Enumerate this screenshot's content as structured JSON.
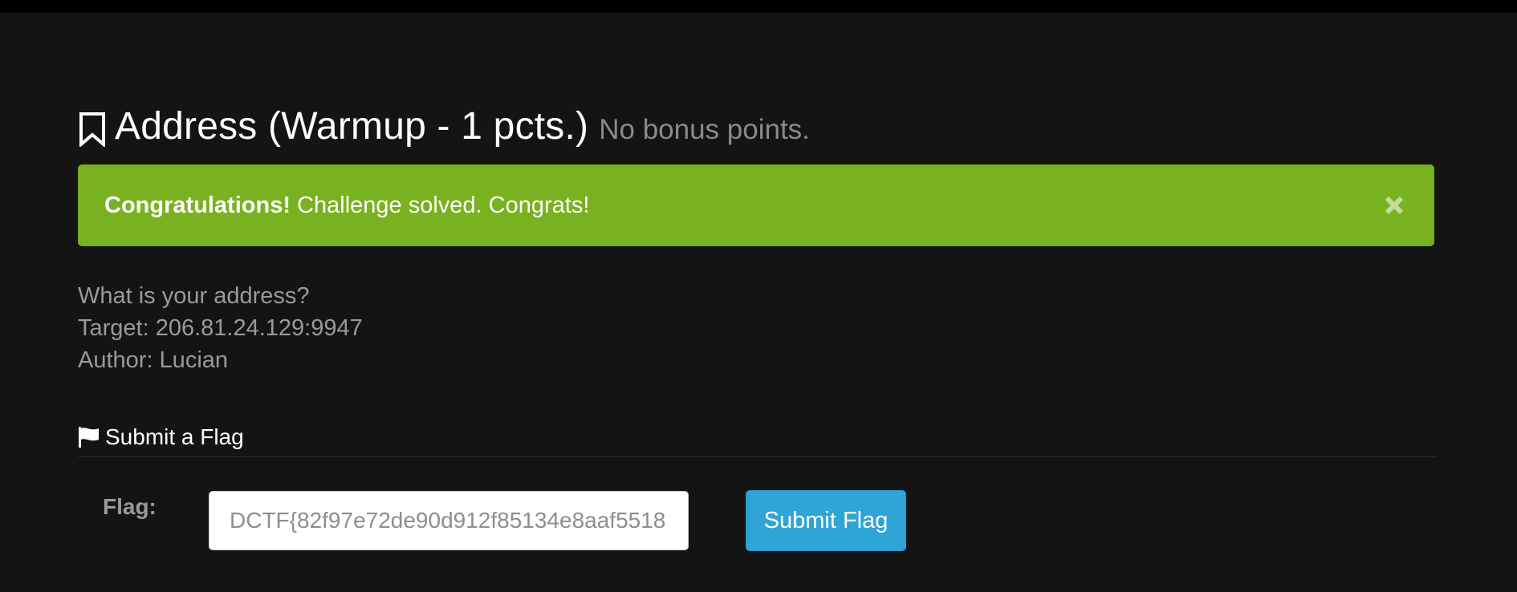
{
  "challenge": {
    "title": "Address (Warmup - 1 pcts.)",
    "subtitle": "No bonus points."
  },
  "alert": {
    "strong": "Congratulations!",
    "message": " Challenge solved. Congrats!",
    "close_icon": "close-icon",
    "color": "#79b221"
  },
  "description": {
    "lines": [
      "What is your address?",
      "Target: 206.81.24.129:9947",
      "Author: Lucian"
    ]
  },
  "submit_section": {
    "header": "Submit a Flag",
    "label": "Flag:",
    "input_value": "DCTF{82f97e72de90d912f85134e8aaf5518",
    "button_label": "Submit Flag",
    "button_color": "#2fa4d7"
  },
  "icons": {
    "title": "bookmark-icon",
    "section": "flag-icon"
  }
}
